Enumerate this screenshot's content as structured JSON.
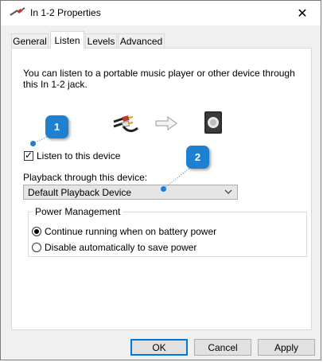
{
  "window": {
    "title": "In 1-2 Properties",
    "close_glyph": "✕"
  },
  "tabs": [
    {
      "label": "General",
      "active": false
    },
    {
      "label": "Listen",
      "active": true
    },
    {
      "label": "Levels",
      "active": false
    },
    {
      "label": "Advanced",
      "active": false
    }
  ],
  "listen": {
    "description": "You can listen to a portable music player or other device through this In 1-2 jack.",
    "checkbox_label": "Listen to this device",
    "checkbox_checked": true,
    "playback_label": "Playback through this device:",
    "playback_selected": "Default Playback Device"
  },
  "power": {
    "legend": "Power Management",
    "options": [
      {
        "label": "Continue running when on battery power",
        "selected": true
      },
      {
        "label": "Disable automatically to save power",
        "selected": false
      }
    ]
  },
  "buttons": {
    "ok": "OK",
    "cancel": "Cancel",
    "apply": "Apply"
  },
  "annotations": {
    "badge1": "1",
    "badge2": "2",
    "color": "#1f7fd1"
  }
}
